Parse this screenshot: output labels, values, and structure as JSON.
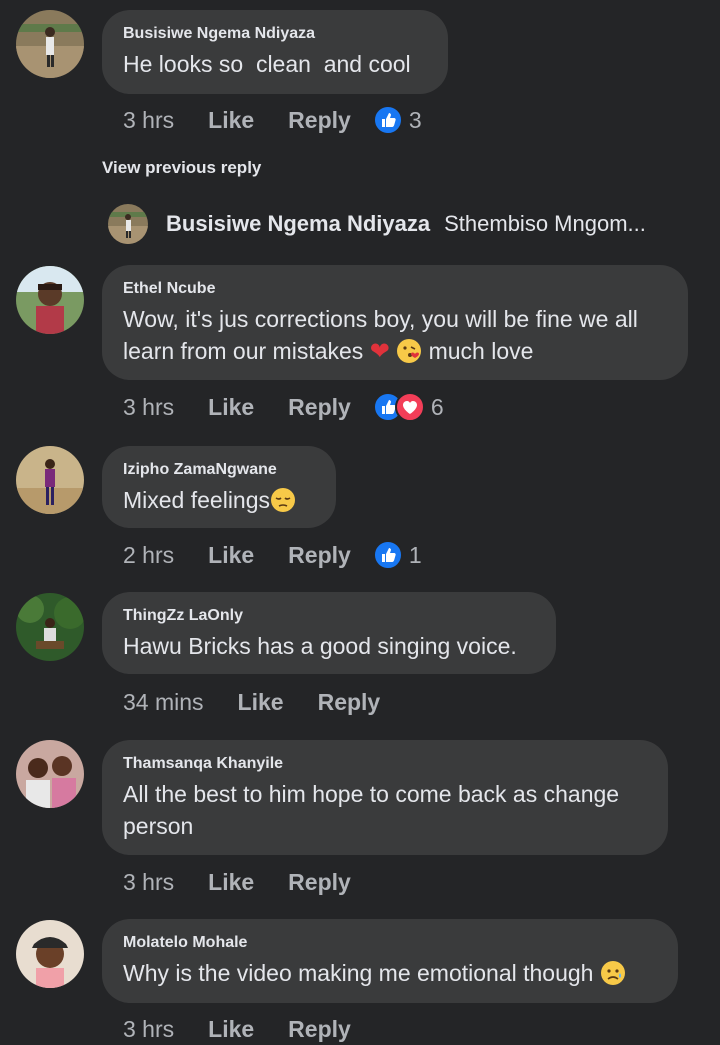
{
  "comments": [
    {
      "author": "Busisiwe Ngema Ndiyaza",
      "text": "He looks so  clean  and cool",
      "time": "3 hrs",
      "like": "Like",
      "reply": "Reply",
      "reactions": "3"
    },
    {
      "author": "Ethel Ncube",
      "text": "Wow, it's jus corrections boy, you will be fine we all learn from our mistakes",
      "text_tail": "much love",
      "time": "3 hrs",
      "like": "Like",
      "reply": "Reply",
      "reactions": "6"
    },
    {
      "author": "Izipho ZamaNgwane",
      "text": "Mixed feelings",
      "time": "2 hrs",
      "like": "Like",
      "reply": "Reply",
      "reactions": "1"
    },
    {
      "author": "ThingZz LaOnly",
      "text": "Hawu Bricks has a good singing voice.",
      "time": "34 mins",
      "like": "Like",
      "reply": "Reply"
    },
    {
      "author": "Thamsanqa Khanyile",
      "text": "All the best to him hope to come back as change person",
      "time": "3 hrs",
      "like": "Like",
      "reply": "Reply"
    },
    {
      "author": "Molatelo Mohale",
      "text": "Why is the video making me emotional though",
      "time": "3 hrs",
      "like": "Like",
      "reply": "Reply"
    }
  ],
  "view_previous": "View previous reply",
  "reply_preview": {
    "author": "Busisiwe Ngema Ndiyaza",
    "text": "Sthembiso Mngom..."
  }
}
